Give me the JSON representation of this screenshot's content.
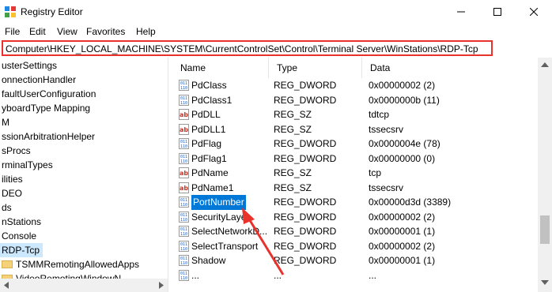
{
  "window": {
    "title": "Registry Editor"
  },
  "menu": [
    "File",
    "Edit",
    "View",
    "Favorites",
    "Help"
  ],
  "address": "Computer\\HKEY_LOCAL_MACHINE\\SYSTEM\\CurrentControlSet\\Control\\Terminal Server\\WinStations\\RDP-Tcp",
  "tree": [
    {
      "label": "usterSettings"
    },
    {
      "label": "onnectionHandler"
    },
    {
      "label": "faultUserConfiguration"
    },
    {
      "label": "yboardType Mapping"
    },
    {
      "label": "M"
    },
    {
      "label": "ssionArbitrationHelper"
    },
    {
      "label": "sProcs"
    },
    {
      "label": "rminalTypes"
    },
    {
      "label": "ilities"
    },
    {
      "label": "DEO"
    },
    {
      "label": "ds"
    },
    {
      "label": "nStations"
    },
    {
      "label": "Console"
    },
    {
      "label": "RDP-Tcp"
    },
    {
      "label": "TSMMRemotingAllowedApps"
    },
    {
      "label": "VideoRemotingWindowN..."
    }
  ],
  "columns": {
    "name": "Name",
    "type": "Type",
    "data": "Data"
  },
  "rows": [
    {
      "name": "PdClass",
      "type": "REG_DWORD",
      "data": "0x00000002 (2)",
      "icon": "dword"
    },
    {
      "name": "PdClass1",
      "type": "REG_DWORD",
      "data": "0x0000000b (11)",
      "icon": "dword"
    },
    {
      "name": "PdDLL",
      "type": "REG_SZ",
      "data": "tdtcp",
      "icon": "string"
    },
    {
      "name": "PdDLL1",
      "type": "REG_SZ",
      "data": "tssecsrv",
      "icon": "string"
    },
    {
      "name": "PdFlag",
      "type": "REG_DWORD",
      "data": "0x0000004e (78)",
      "icon": "dword"
    },
    {
      "name": "PdFlag1",
      "type": "REG_DWORD",
      "data": "0x00000000 (0)",
      "icon": "dword"
    },
    {
      "name": "PdName",
      "type": "REG_SZ",
      "data": "tcp",
      "icon": "string"
    },
    {
      "name": "PdName1",
      "type": "REG_SZ",
      "data": "tssecsrv",
      "icon": "string"
    },
    {
      "name": "PortNumber",
      "type": "REG_DWORD",
      "data": "0x00000d3d (3389)",
      "icon": "dword"
    },
    {
      "name": "SecurityLayer",
      "type": "REG_DWORD",
      "data": "0x00000002 (2)",
      "icon": "dword"
    },
    {
      "name": "SelectNetworkD...",
      "type": "REG_DWORD",
      "data": "0x00000001 (1)",
      "icon": "dword"
    },
    {
      "name": "SelectTransport",
      "type": "REG_DWORD",
      "data": "0x00000002 (2)",
      "icon": "dword"
    },
    {
      "name": "Shadow",
      "type": "REG_DWORD",
      "data": "0x00000001 (1)",
      "icon": "dword"
    },
    {
      "name": "...",
      "type": "...",
      "data": "...",
      "icon": "dword"
    }
  ],
  "colors": {
    "highlight": "#0078d7",
    "annotation": "#e8322b"
  }
}
